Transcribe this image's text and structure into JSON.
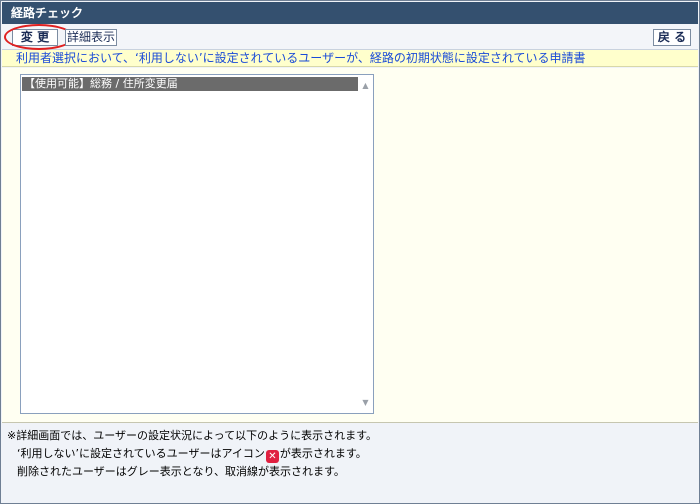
{
  "window": {
    "title": "経路チェック"
  },
  "toolbar": {
    "change_label": "変 更",
    "detail_label": "詳細表示",
    "back_label": "戻 る"
  },
  "notice": {
    "text": "利用者選択において、‘利用しない’に設定されているユーザーが、経路の初期状態に設定されている申請書"
  },
  "list": {
    "items": [
      {
        "label": "【使用可能】総務 / 住所変更届",
        "selected": true
      }
    ],
    "scroll_up_icon": "▲",
    "scroll_down_icon": "▼"
  },
  "footnotes": {
    "line1": "※詳細画面では、ユーザーの設定状況によって以下のように表示されます。",
    "line2_before": "‘利用しない’に設定されているユーザーはアイコン",
    "line2_after": "が表示されます。",
    "line3": "削除されたユーザーはグレー表示となり、取消線が表示されます。",
    "unused_icon": "x-icon",
    "unused_icon_glyph": "✕"
  },
  "colors": {
    "titlebar": "#34506f",
    "notice_bg": "#ffffcc",
    "notice_text": "#1a4bd8",
    "highlight_circle": "#e02020",
    "selected_item": "#6b6b6b"
  }
}
